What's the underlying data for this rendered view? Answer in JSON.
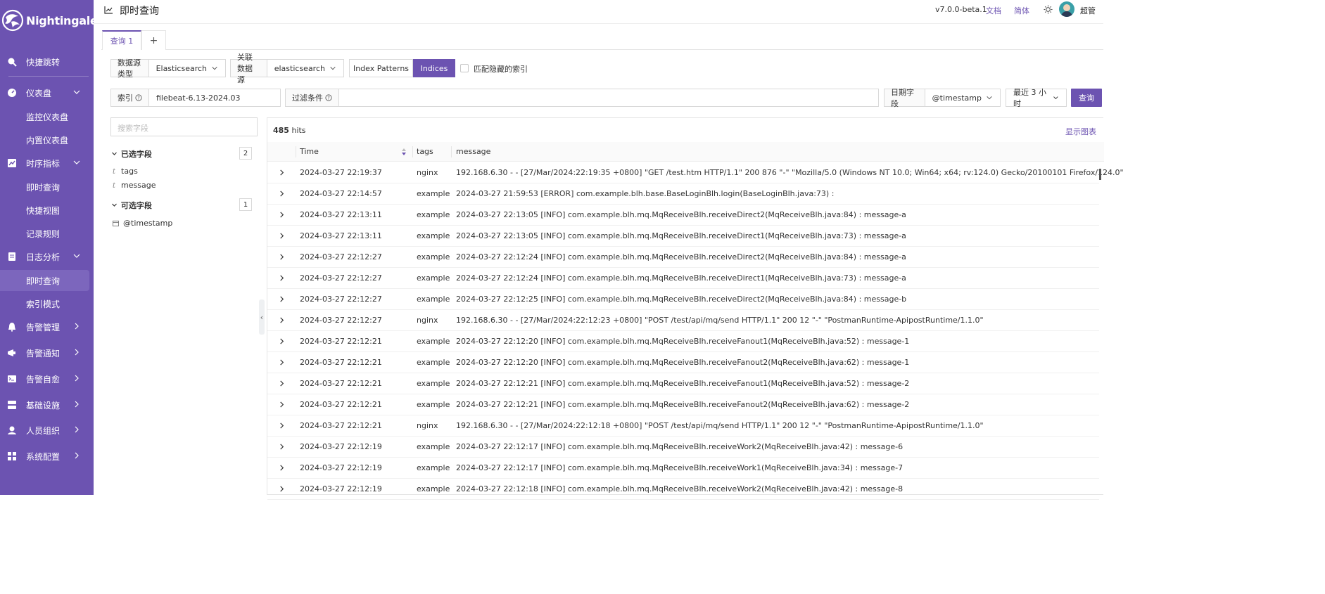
{
  "app": {
    "brand": "Nightingale",
    "page_title": "即时查询"
  },
  "header": {
    "version": "v7.0.0-beta.1",
    "docs": "文档",
    "lang": "简体",
    "user": "超管"
  },
  "sidebar": {
    "items": [
      {
        "label": "快捷跳转"
      },
      {
        "label": "仪表盘"
      },
      {
        "label": "监控仪表盘"
      },
      {
        "label": "内置仪表盘"
      },
      {
        "label": "时序指标"
      },
      {
        "label": "即时查询"
      },
      {
        "label": "快捷视图"
      },
      {
        "label": "记录规则"
      },
      {
        "label": "日志分析"
      },
      {
        "label": "即时查询"
      },
      {
        "label": "索引模式"
      },
      {
        "label": "告警管理"
      },
      {
        "label": "告警通知"
      },
      {
        "label": "告警自愈"
      },
      {
        "label": "基础设施"
      },
      {
        "label": "人员组织"
      },
      {
        "label": "系统配置"
      }
    ]
  },
  "tabs": {
    "query1": "查询 1",
    "add": "+"
  },
  "datasource": {
    "type_label": "数据源类型",
    "type_value": "Elasticsearch",
    "assoc_label": "关联数据源",
    "assoc_value": "elasticsearch",
    "index_patterns": "Index Patterns",
    "indices": "Indices",
    "match_hidden": "匹配隐藏的索引"
  },
  "query": {
    "index_label": "索引",
    "index_value": "filebeat-6.13-2024.03",
    "filter_label": "过滤条件",
    "date_field_label": "日期字段",
    "date_field_value": "@timestamp",
    "range": "最近 3 小时",
    "submit": "查询"
  },
  "fields": {
    "search_placeholder": "搜索字段",
    "selected_title": "已选字段",
    "selected_count": "2",
    "selected": [
      "tags",
      "message"
    ],
    "available_title": "可选字段",
    "available_count": "1",
    "available": [
      "@timestamp"
    ],
    "type_glyph": "t"
  },
  "results": {
    "hits_count": "485",
    "hits_word": "hits",
    "show_chart": "显示图表",
    "columns": {
      "time": "Time",
      "tags": "tags",
      "message": "message"
    },
    "rows": [
      {
        "time": "2024-03-27 22:19:37",
        "tags": "nginx",
        "message": "192.168.6.30 - - [27/Mar/2024:22:19:35 +0800] \"GET /test.htm HTTP/1.1\" 200 876 \"-\" \"Mozilla/5.0 (Windows NT 10.0; Win64; x64; rv:124.0) Gecko/20100101 Firefox/124.0\""
      },
      {
        "time": "2024-03-27 22:14:57",
        "tags": "example",
        "message": "2024-03-27 21:59:53 [ERROR] com.example.blh.base.BaseLoginBlh.login(BaseLoginBlh.java:73) :"
      },
      {
        "time": "2024-03-27 22:13:11",
        "tags": "example",
        "message": "2024-03-27 22:13:05 [INFO] com.example.blh.mq.MqReceiveBlh.receiveDirect2(MqReceiveBlh.java:84) : message-a"
      },
      {
        "time": "2024-03-27 22:13:11",
        "tags": "example",
        "message": "2024-03-27 22:13:05 [INFO] com.example.blh.mq.MqReceiveBlh.receiveDirect1(MqReceiveBlh.java:73) : message-a"
      },
      {
        "time": "2024-03-27 22:12:27",
        "tags": "example",
        "message": "2024-03-27 22:12:24 [INFO] com.example.blh.mq.MqReceiveBlh.receiveDirect2(MqReceiveBlh.java:84) : message-a"
      },
      {
        "time": "2024-03-27 22:12:27",
        "tags": "example",
        "message": "2024-03-27 22:12:24 [INFO] com.example.blh.mq.MqReceiveBlh.receiveDirect1(MqReceiveBlh.java:73) : message-a"
      },
      {
        "time": "2024-03-27 22:12:27",
        "tags": "example",
        "message": "2024-03-27 22:12:25 [INFO] com.example.blh.mq.MqReceiveBlh.receiveDirect2(MqReceiveBlh.java:84) : message-b"
      },
      {
        "time": "2024-03-27 22:12:27",
        "tags": "nginx",
        "message": "192.168.6.30 - - [27/Mar/2024:22:12:23 +0800] \"POST /test/api/mq/send HTTP/1.1\" 200 12 \"-\" \"PostmanRuntime-ApipostRuntime/1.1.0\""
      },
      {
        "time": "2024-03-27 22:12:21",
        "tags": "example",
        "message": "2024-03-27 22:12:20 [INFO] com.example.blh.mq.MqReceiveBlh.receiveFanout1(MqReceiveBlh.java:52) : message-1"
      },
      {
        "time": "2024-03-27 22:12:21",
        "tags": "example",
        "message": "2024-03-27 22:12:20 [INFO] com.example.blh.mq.MqReceiveBlh.receiveFanout2(MqReceiveBlh.java:62) : message-1"
      },
      {
        "time": "2024-03-27 22:12:21",
        "tags": "example",
        "message": "2024-03-27 22:12:21 [INFO] com.example.blh.mq.MqReceiveBlh.receiveFanout1(MqReceiveBlh.java:52) : message-2"
      },
      {
        "time": "2024-03-27 22:12:21",
        "tags": "example",
        "message": "2024-03-27 22:12:21 [INFO] com.example.blh.mq.MqReceiveBlh.receiveFanout2(MqReceiveBlh.java:62) : message-2"
      },
      {
        "time": "2024-03-27 22:12:21",
        "tags": "nginx",
        "message": "192.168.6.30 - - [27/Mar/2024:22:12:18 +0800] \"POST /test/api/mq/send HTTP/1.1\" 200 12 \"-\" \"PostmanRuntime-ApipostRuntime/1.1.0\""
      },
      {
        "time": "2024-03-27 22:12:19",
        "tags": "example",
        "message": "2024-03-27 22:12:17 [INFO] com.example.blh.mq.MqReceiveBlh.receiveWork2(MqReceiveBlh.java:42) : message-6"
      },
      {
        "time": "2024-03-27 22:12:19",
        "tags": "example",
        "message": "2024-03-27 22:12:17 [INFO] com.example.blh.mq.MqReceiveBlh.receiveWork1(MqReceiveBlh.java:34) : message-7"
      },
      {
        "time": "2024-03-27 22:12:19",
        "tags": "example",
        "message": "2024-03-27 22:12:18 [INFO] com.example.blh.mq.MqReceiveBlh.receiveWork2(MqReceiveBlh.java:42) : message-8"
      }
    ]
  },
  "colors": {
    "accent": "#6c53b1",
    "sidebar": "#6c53b1"
  },
  "icons": [
    "nightingale-logo",
    "search-icon",
    "dashboard-icon",
    "metrics-icon",
    "log-icon",
    "alert-icon",
    "notify-icon",
    "self-heal-icon",
    "infra-icon",
    "user-icon",
    "settings-icon",
    "chart-icon",
    "sun-icon",
    "help-icon",
    "calendar-icon"
  ]
}
